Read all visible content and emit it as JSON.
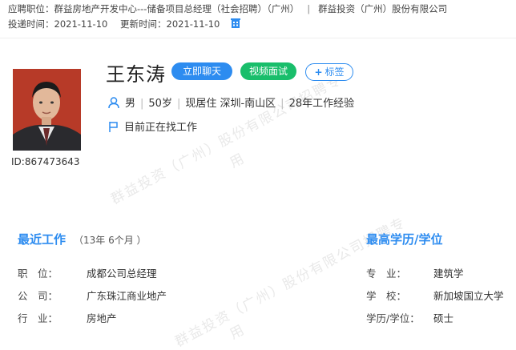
{
  "header": {
    "position_label": "应聘职位：",
    "position_value": "群益房地产开发中心---储备项目总经理（社会招聘）（广州）",
    "separator": "|",
    "company": "群益投资（广州）股份有限公司",
    "submit_label": "投递时间：",
    "submit_date": "2021-11-10",
    "update_label": "更新时间：",
    "update_date": "2021-11-10"
  },
  "profile": {
    "id_text": "ID:867473643",
    "name": "王东涛",
    "buttons": {
      "chat": "立即聊天",
      "video": "视频面试",
      "tag": "标签"
    },
    "gender": "男",
    "age": "50岁",
    "residence": "现居住 深圳-南山区",
    "experience": "28年工作经验",
    "status": "目前正在找工作"
  },
  "watermark": {
    "line1": "群益投资（广州）股份有限公司招聘专",
    "line2": "用"
  },
  "recent_work": {
    "title": "最近工作",
    "duration": "（13年 6个月 ）",
    "rows": [
      {
        "label": "职　位：",
        "value": "成都公司总经理"
      },
      {
        "label": "公　司：",
        "value": "广东珠江商业地产"
      },
      {
        "label": "行　业：",
        "value": "房地产"
      }
    ]
  },
  "education": {
    "title": "最高学历/学位",
    "rows": [
      {
        "label": "专　业：",
        "value": "建筑学"
      },
      {
        "label": "学　校：",
        "value": "新加坡国立大学"
      },
      {
        "label": "学历/学位：",
        "value": "硕士"
      }
    ]
  },
  "colors": {
    "accent": "#2d8cf0",
    "green": "#19be6b"
  }
}
